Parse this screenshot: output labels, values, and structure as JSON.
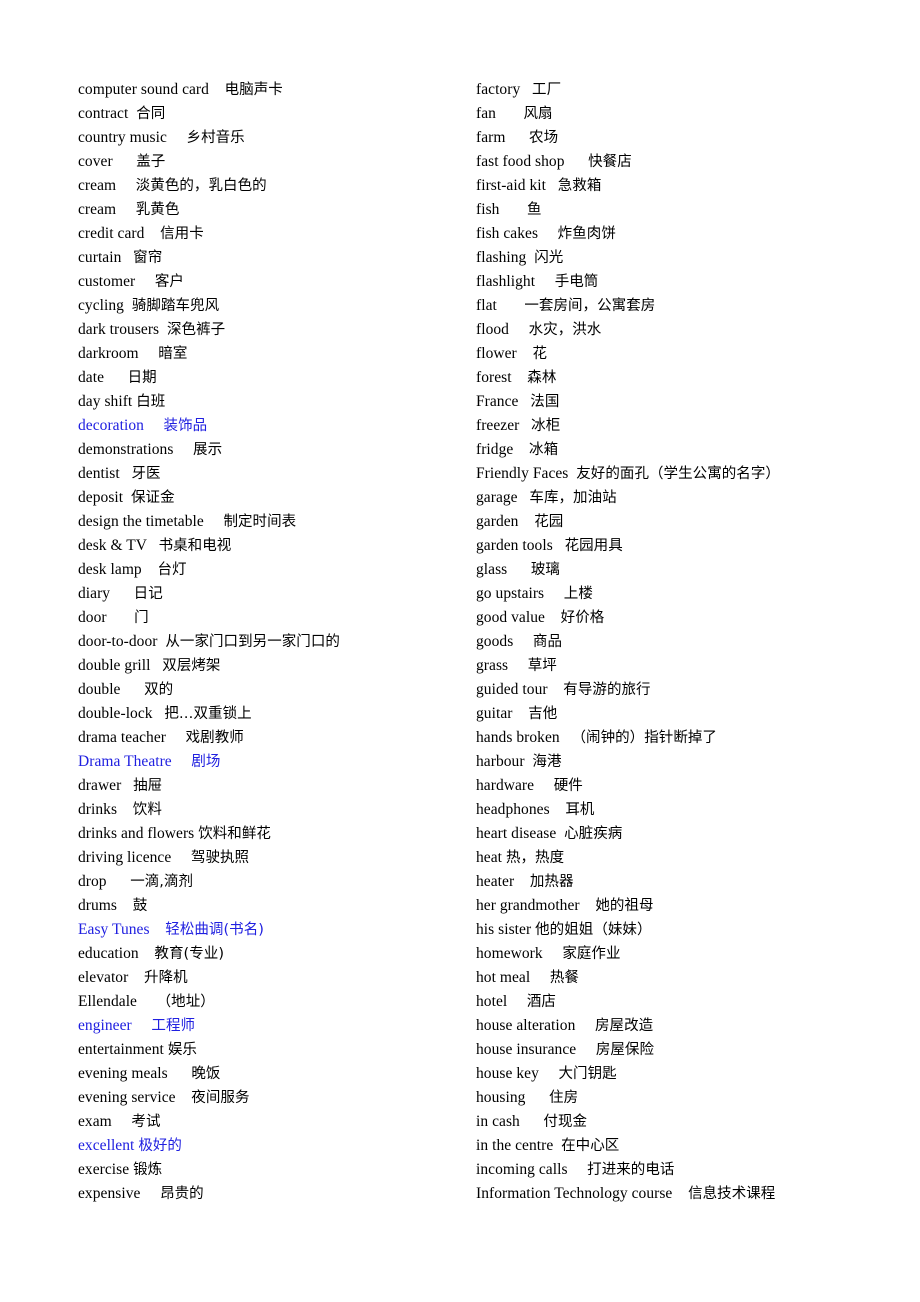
{
  "document": {
    "type": "bilingual-glossary",
    "title_visible": false,
    "page_background": "#ffffff",
    "text_color": "#000000",
    "highlight_color": "#2020e0",
    "columns": 2
  },
  "left_column": {
    "entries": [
      {
        "term": "computer sound card",
        "gap": "    ",
        "gloss": "电脑声卡",
        "color": "black"
      },
      {
        "term": "contract",
        "gap": "  ",
        "gloss": "合同",
        "color": "black"
      },
      {
        "term": "country music",
        "gap": "     ",
        "gloss": "乡村音乐",
        "color": "black"
      },
      {
        "term": "cover",
        "gap": "      ",
        "gloss": "盖子",
        "color": "black"
      },
      {
        "term": "cream",
        "gap": "     ",
        "gloss": "淡黄色的，乳白色的",
        "color": "black"
      },
      {
        "term": "cream",
        "gap": "     ",
        "gloss": "乳黄色",
        "color": "black"
      },
      {
        "term": "credit card",
        "gap": "    ",
        "gloss": "信用卡",
        "color": "black"
      },
      {
        "term": "curtain",
        "gap": "   ",
        "gloss": "窗帘",
        "color": "black"
      },
      {
        "term": "customer",
        "gap": "     ",
        "gloss": "客户",
        "color": "black"
      },
      {
        "term": "cycling",
        "gap": "  ",
        "gloss": "骑脚踏车兜风",
        "color": "black"
      },
      {
        "term": "dark trousers",
        "gap": "  ",
        "gloss": "深色裤子",
        "color": "black"
      },
      {
        "term": "darkroom",
        "gap": "     ",
        "gloss": "暗室",
        "color": "black"
      },
      {
        "term": "date",
        "gap": "      ",
        "gloss": "日期",
        "color": "black"
      },
      {
        "term": "day shift",
        "gap": " ",
        "gloss": "白班",
        "color": "black"
      },
      {
        "term": "decoration",
        "gap": "     ",
        "gloss": "装饰品",
        "color": "blue"
      },
      {
        "term": "demonstrations",
        "gap": "     ",
        "gloss": "展示",
        "color": "black"
      },
      {
        "term": "dentist",
        "gap": "   ",
        "gloss": "牙医",
        "color": "black"
      },
      {
        "term": "deposit",
        "gap": "  ",
        "gloss": "保证金",
        "color": "black"
      },
      {
        "term": "design the timetable",
        "gap": "     ",
        "gloss": "制定时间表",
        "color": "black"
      },
      {
        "term": "desk & TV",
        "gap": "   ",
        "gloss": "书桌和电视",
        "color": "black"
      },
      {
        "term": "desk lamp",
        "gap": "    ",
        "gloss": "台灯",
        "color": "black"
      },
      {
        "term": "diary",
        "gap": "      ",
        "gloss": "日记",
        "color": "black"
      },
      {
        "term": "door",
        "gap": "       ",
        "gloss": "门",
        "color": "black"
      },
      {
        "term": "door-to-door",
        "gap": "  ",
        "gloss": "从一家门口到另一家门口的",
        "color": "black"
      },
      {
        "term": "double grill",
        "gap": "   ",
        "gloss": "双层烤架",
        "color": "black"
      },
      {
        "term": "double",
        "gap": "      ",
        "gloss": "双的",
        "color": "black"
      },
      {
        "term": "double-lock",
        "gap": "   ",
        "gloss": "把…双重锁上",
        "color": "black"
      },
      {
        "term": "drama teacher",
        "gap": "     ",
        "gloss": "戏剧教师",
        "color": "black"
      },
      {
        "term": "Drama Theatre",
        "gap": "     ",
        "gloss": "剧场",
        "color": "blue"
      },
      {
        "term": "drawer",
        "gap": "   ",
        "gloss": "抽屉",
        "color": "black"
      },
      {
        "term": "drinks",
        "gap": "    ",
        "gloss": "饮料",
        "color": "black"
      },
      {
        "term": "drinks and flowers",
        "gap": " ",
        "gloss": "饮料和鲜花",
        "color": "black"
      },
      {
        "term": "driving licence",
        "gap": "     ",
        "gloss": "驾驶执照",
        "color": "black"
      },
      {
        "term": "drop",
        "gap": "      ",
        "gloss": "一滴,滴剂",
        "color": "black"
      },
      {
        "term": "drums",
        "gap": "    ",
        "gloss": "鼓",
        "color": "black"
      },
      {
        "term": "Easy Tunes",
        "gap": "    ",
        "gloss": "轻松曲调(书名)",
        "color": "blue"
      },
      {
        "term": "education",
        "gap": "    ",
        "gloss": "教育(专业)",
        "color": "black"
      },
      {
        "term": "elevator",
        "gap": "    ",
        "gloss": "升降机",
        "color": "black"
      },
      {
        "term": "Ellendale",
        "gap": "     ",
        "gloss": "（地址）",
        "color": "black"
      },
      {
        "term": "engineer",
        "gap": "     ",
        "gloss": "工程师",
        "color": "blue"
      },
      {
        "term": "entertainment",
        "gap": " ",
        "gloss": "娱乐",
        "color": "black"
      },
      {
        "term": "evening meals",
        "gap": "      ",
        "gloss": "晚饭",
        "color": "black"
      },
      {
        "term": "evening service",
        "gap": "    ",
        "gloss": "夜间服务",
        "color": "black"
      },
      {
        "term": "exam",
        "gap": "     ",
        "gloss": "考试",
        "color": "black"
      },
      {
        "term": "excellent",
        "gap": " ",
        "gloss": "极好的",
        "color": "blue"
      },
      {
        "term": "exercise",
        "gap": " ",
        "gloss": "锻炼",
        "color": "black"
      },
      {
        "term": "expensive",
        "gap": "     ",
        "gloss": "昂贵的",
        "color": "black"
      }
    ]
  },
  "right_column": {
    "entries": [
      {
        "term": "factory",
        "gap": "   ",
        "gloss": "工厂",
        "color": "black"
      },
      {
        "term": "fan",
        "gap": "       ",
        "gloss": "风扇",
        "color": "black"
      },
      {
        "term": "farm",
        "gap": "      ",
        "gloss": "农场",
        "color": "black"
      },
      {
        "term": "fast food shop",
        "gap": "      ",
        "gloss": "快餐店",
        "color": "black"
      },
      {
        "term": "first-aid kit",
        "gap": "   ",
        "gloss": "急救箱",
        "color": "black"
      },
      {
        "term": "fish",
        "gap": "       ",
        "gloss": "鱼",
        "color": "black"
      },
      {
        "term": "fish cakes",
        "gap": "     ",
        "gloss": "炸鱼肉饼",
        "color": "black"
      },
      {
        "term": "flashing",
        "gap": "  ",
        "gloss": "闪光",
        "color": "black"
      },
      {
        "term": "flashlight",
        "gap": "     ",
        "gloss": "手电筒",
        "color": "black"
      },
      {
        "term": "flat",
        "gap": "       ",
        "gloss": "一套房间，公寓套房",
        "color": "black"
      },
      {
        "term": "flood",
        "gap": "     ",
        "gloss": "水灾，洪水",
        "color": "black"
      },
      {
        "term": "flower",
        "gap": "    ",
        "gloss": "花",
        "color": "black"
      },
      {
        "term": "forest",
        "gap": "    ",
        "gloss": "森林",
        "color": "black"
      },
      {
        "term": "France",
        "gap": "   ",
        "gloss": "法国",
        "color": "black"
      },
      {
        "term": "freezer",
        "gap": "   ",
        "gloss": "冰柜",
        "color": "black"
      },
      {
        "term": "fridge",
        "gap": "    ",
        "gloss": "冰箱",
        "color": "black"
      },
      {
        "term": "Friendly Faces",
        "gap": "  ",
        "gloss": "友好的面孔（学生公寓的名字）",
        "color": "black"
      },
      {
        "term": "garage",
        "gap": "   ",
        "gloss": "车库，加油站",
        "color": "black"
      },
      {
        "term": "garden",
        "gap": "    ",
        "gloss": "花园",
        "color": "black"
      },
      {
        "term": "garden tools",
        "gap": "   ",
        "gloss": "花园用具",
        "color": "black"
      },
      {
        "term": "glass",
        "gap": "      ",
        "gloss": "玻璃",
        "color": "black"
      },
      {
        "term": "go upstairs",
        "gap": "     ",
        "gloss": "上楼",
        "color": "black"
      },
      {
        "term": "good value",
        "gap": "    ",
        "gloss": "好价格",
        "color": "black"
      },
      {
        "term": "goods",
        "gap": "     ",
        "gloss": "商品",
        "color": "black"
      },
      {
        "term": "grass",
        "gap": "     ",
        "gloss": "草坪",
        "color": "black"
      },
      {
        "term": "guided tour",
        "gap": "    ",
        "gloss": "有导游的旅行",
        "color": "black"
      },
      {
        "term": "guitar",
        "gap": "    ",
        "gloss": "吉他",
        "color": "black"
      },
      {
        "term": "hands broken",
        "gap": "   ",
        "gloss": "（闹钟的）指针断掉了",
        "color": "black"
      },
      {
        "term": "harbour",
        "gap": "  ",
        "gloss": "海港",
        "color": "black"
      },
      {
        "term": "hardware",
        "gap": "     ",
        "gloss": "硬件",
        "color": "black"
      },
      {
        "term": "headphones",
        "gap": "    ",
        "gloss": "耳机",
        "color": "black"
      },
      {
        "term": "heart disease",
        "gap": "  ",
        "gloss": "心脏疾病",
        "color": "black"
      },
      {
        "term": "heat",
        "gap": " ",
        "gloss": "热，热度",
        "color": "black"
      },
      {
        "term": "heater",
        "gap": "    ",
        "gloss": "加热器",
        "color": "black"
      },
      {
        "term": "her grandmother",
        "gap": "    ",
        "gloss": "她的祖母",
        "color": "black"
      },
      {
        "term": "his sister",
        "gap": " ",
        "gloss": "他的姐姐（妹妹）",
        "color": "black"
      },
      {
        "term": "homework",
        "gap": "     ",
        "gloss": "家庭作业",
        "color": "black"
      },
      {
        "term": "hot meal",
        "gap": "     ",
        "gloss": "热餐",
        "color": "black"
      },
      {
        "term": "hotel",
        "gap": "     ",
        "gloss": "酒店",
        "color": "black"
      },
      {
        "term": "house alteration",
        "gap": "     ",
        "gloss": "房屋改造",
        "color": "black"
      },
      {
        "term": "house insurance",
        "gap": "     ",
        "gloss": "房屋保险",
        "color": "black"
      },
      {
        "term": "house key",
        "gap": "     ",
        "gloss": "大门钥匙",
        "color": "black"
      },
      {
        "term": "housing",
        "gap": "      ",
        "gloss": "住房",
        "color": "black"
      },
      {
        "term": "in cash",
        "gap": "      ",
        "gloss": "付现金",
        "color": "black"
      },
      {
        "term": "in the centre",
        "gap": "  ",
        "gloss": "在中心区",
        "color": "black"
      },
      {
        "term": "incoming calls",
        "gap": "     ",
        "gloss": "打进来的电话",
        "color": "black"
      },
      {
        "term": "Information Technology course",
        "gap": "    ",
        "gloss": "信息技术课程",
        "color": "black"
      }
    ]
  }
}
